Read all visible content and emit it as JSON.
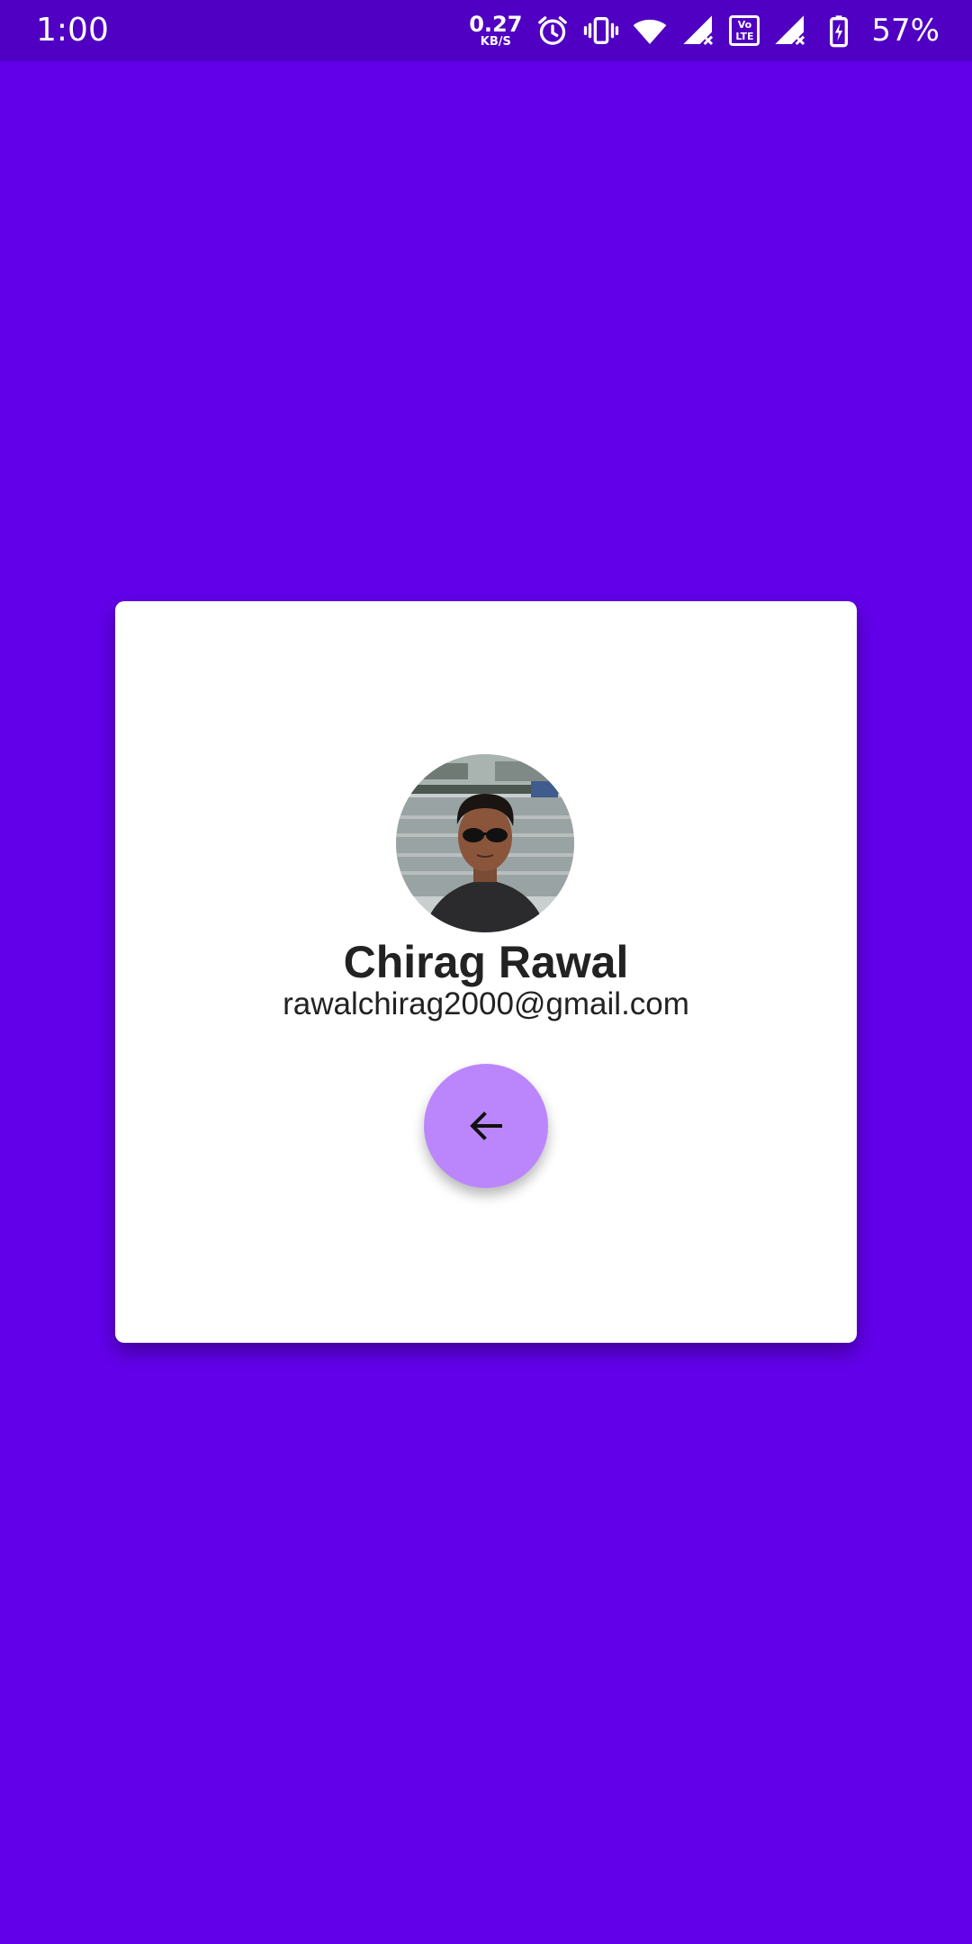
{
  "status_bar": {
    "time": "1:00",
    "net_speed_value": "0.27",
    "net_speed_unit": "KB/S",
    "volte_top": "Vo",
    "volte_bottom": "LTE",
    "battery_percent": "57%",
    "icons": [
      "alarm-icon",
      "vibrate-icon",
      "wifi-icon",
      "signal-icon",
      "volte-icon",
      "signal-icon",
      "battery-charging-icon"
    ]
  },
  "profile": {
    "name": "Chirag Rawal",
    "email": "rawalchirag2000@gmail.com",
    "avatar_icon": "user-photo"
  },
  "back_button": {
    "icon": "arrow-left-icon"
  },
  "colors": {
    "background": "#6200ea",
    "status_bar": "#5000c2",
    "card": "#ffffff",
    "fab": "#bb86fc",
    "text": "#222222"
  }
}
